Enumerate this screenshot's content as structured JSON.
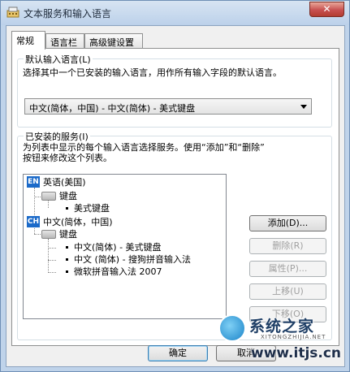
{
  "window": {
    "title": "文本服务和输入语言",
    "close_label": "✕"
  },
  "tabs": [
    {
      "label": "常规",
      "active": true
    },
    {
      "label": "语言栏",
      "active": false
    },
    {
      "label": "高级键设置",
      "active": false
    }
  ],
  "default_language": {
    "group_label": "默认输入语言(L)",
    "description": "选择其中一个已安装的输入语言，用作所有输入字段的默认语言。",
    "selected": "中文(简体，中国) - 中文(简体) - 美式键盘"
  },
  "installed_services": {
    "group_label": "已安装的服务(I)",
    "description_line1": "为列表中显示的每个输入语言选择服务。使用“添加”和“删除”",
    "description_line2": "按钮来修改这个列表。",
    "tree": {
      "lang1": {
        "badge": "EN",
        "label": "英语(美国)"
      },
      "lang1_keyboard": "键盘",
      "lang1_item1": "美式键盘",
      "lang2": {
        "badge": "CH",
        "label": "中文(简体，中国)"
      },
      "lang2_keyboard": "键盘",
      "lang2_item1": "中文(简体) - 美式键盘",
      "lang2_item2": "中文 (简体) - 搜狗拼音输入法",
      "lang2_item3": "微软拼音输入法 2007"
    },
    "buttons": {
      "add": "添加(D)...",
      "remove": "删除(R)",
      "properties": "属性(P)...",
      "move_up": "上移(U)",
      "move_down": "下移(O)"
    }
  },
  "footer": {
    "ok": "确定",
    "cancel": "取消"
  },
  "watermark": {
    "brand": "系统之家",
    "subtext": "XITONGZHIJIA.NET",
    "url": "www.itjs.cn"
  },
  "colors": {
    "accent": "#1b6ac9",
    "title_bar": "#bfd3ea",
    "close_button": "#c75050"
  }
}
